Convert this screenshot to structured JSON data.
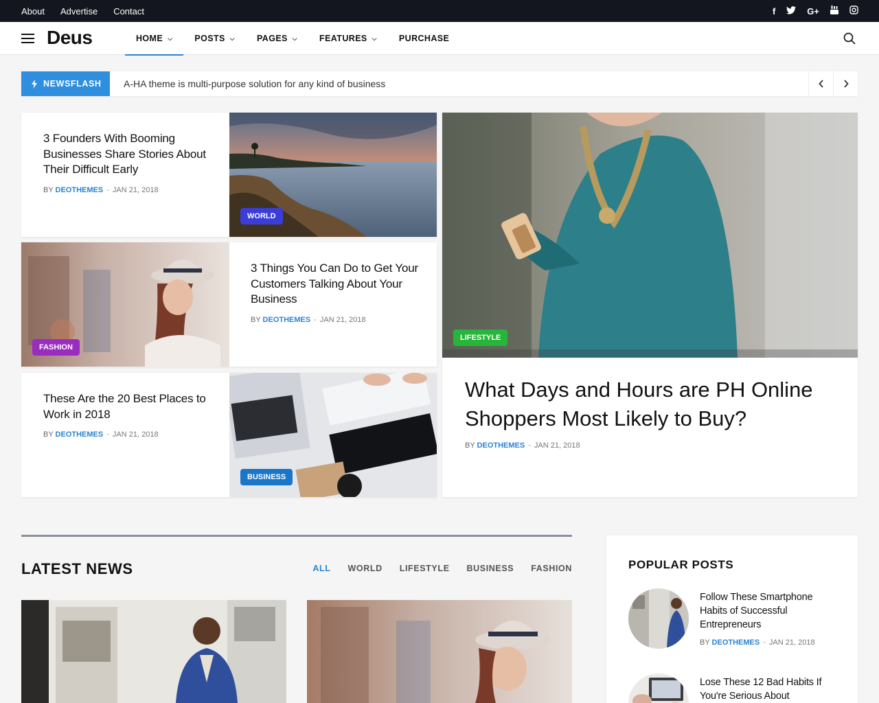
{
  "topbar": {
    "links": [
      "About",
      "Advertise",
      "Contact"
    ],
    "social": [
      "f",
      "t",
      "G+",
      "yt",
      "ig"
    ]
  },
  "header": {
    "logo": "Deus",
    "nav": [
      {
        "label": "HOME",
        "dropdown": true,
        "active": true
      },
      {
        "label": "POSTS",
        "dropdown": true
      },
      {
        "label": "PAGES",
        "dropdown": true
      },
      {
        "label": "FEATURES",
        "dropdown": true
      },
      {
        "label": "PURCHASE",
        "dropdown": false
      }
    ]
  },
  "newsflash": {
    "label": "NEWSFLASH",
    "text": "A-HA theme is multi-purpose solution for any kind of business"
  },
  "featured": [
    {
      "title": "3 Founders With Booming Businesses Share Stories About Their Difficult Early",
      "by": "BY",
      "author": "DEOTHEMES",
      "date": "JAN 21, 2018",
      "tag": "WORLD",
      "tag_color": "#3b3dd8"
    },
    {
      "title": "3 Things You Can Do to Get Your Customers Talking About Your Business",
      "by": "BY",
      "author": "DEOTHEMES",
      "date": "JAN 21, 2018",
      "tag": "FASHION",
      "tag_color": "#9a2cc0"
    },
    {
      "title": "These Are the 20 Best Places to Work in 2018",
      "by": "BY",
      "author": "DEOTHEMES",
      "date": "JAN 21, 2018",
      "tag": "BUSINESS",
      "tag_color": "#1a76c9"
    },
    {
      "title": "What Days and Hours are PH Online Shoppers Most Likely to Buy?",
      "by": "BY",
      "author": "DEOTHEMES",
      "date": "JAN 21, 2018",
      "tag": "LIFESTYLE",
      "tag_color": "#27b53a"
    }
  ],
  "latest": {
    "title": "LATEST NEWS",
    "filters": [
      "ALL",
      "WORLD",
      "LIFESTYLE",
      "BUSINESS",
      "FASHION"
    ],
    "active_filter": "ALL"
  },
  "popular": {
    "title": "POPULAR POSTS",
    "items": [
      {
        "title": "Follow These Smartphone Habits of Successful Entrepreneurs",
        "by": "BY",
        "author": "DEOTHEMES",
        "date": "JAN 21, 2018"
      },
      {
        "title": "Lose These 12 Bad Habits If You're Serious About",
        "by": "",
        "author": "",
        "date": ""
      }
    ]
  },
  "colors": {
    "accent": "#2a84d2",
    "topbar": "#14161f",
    "badge": "#2f8fde"
  }
}
